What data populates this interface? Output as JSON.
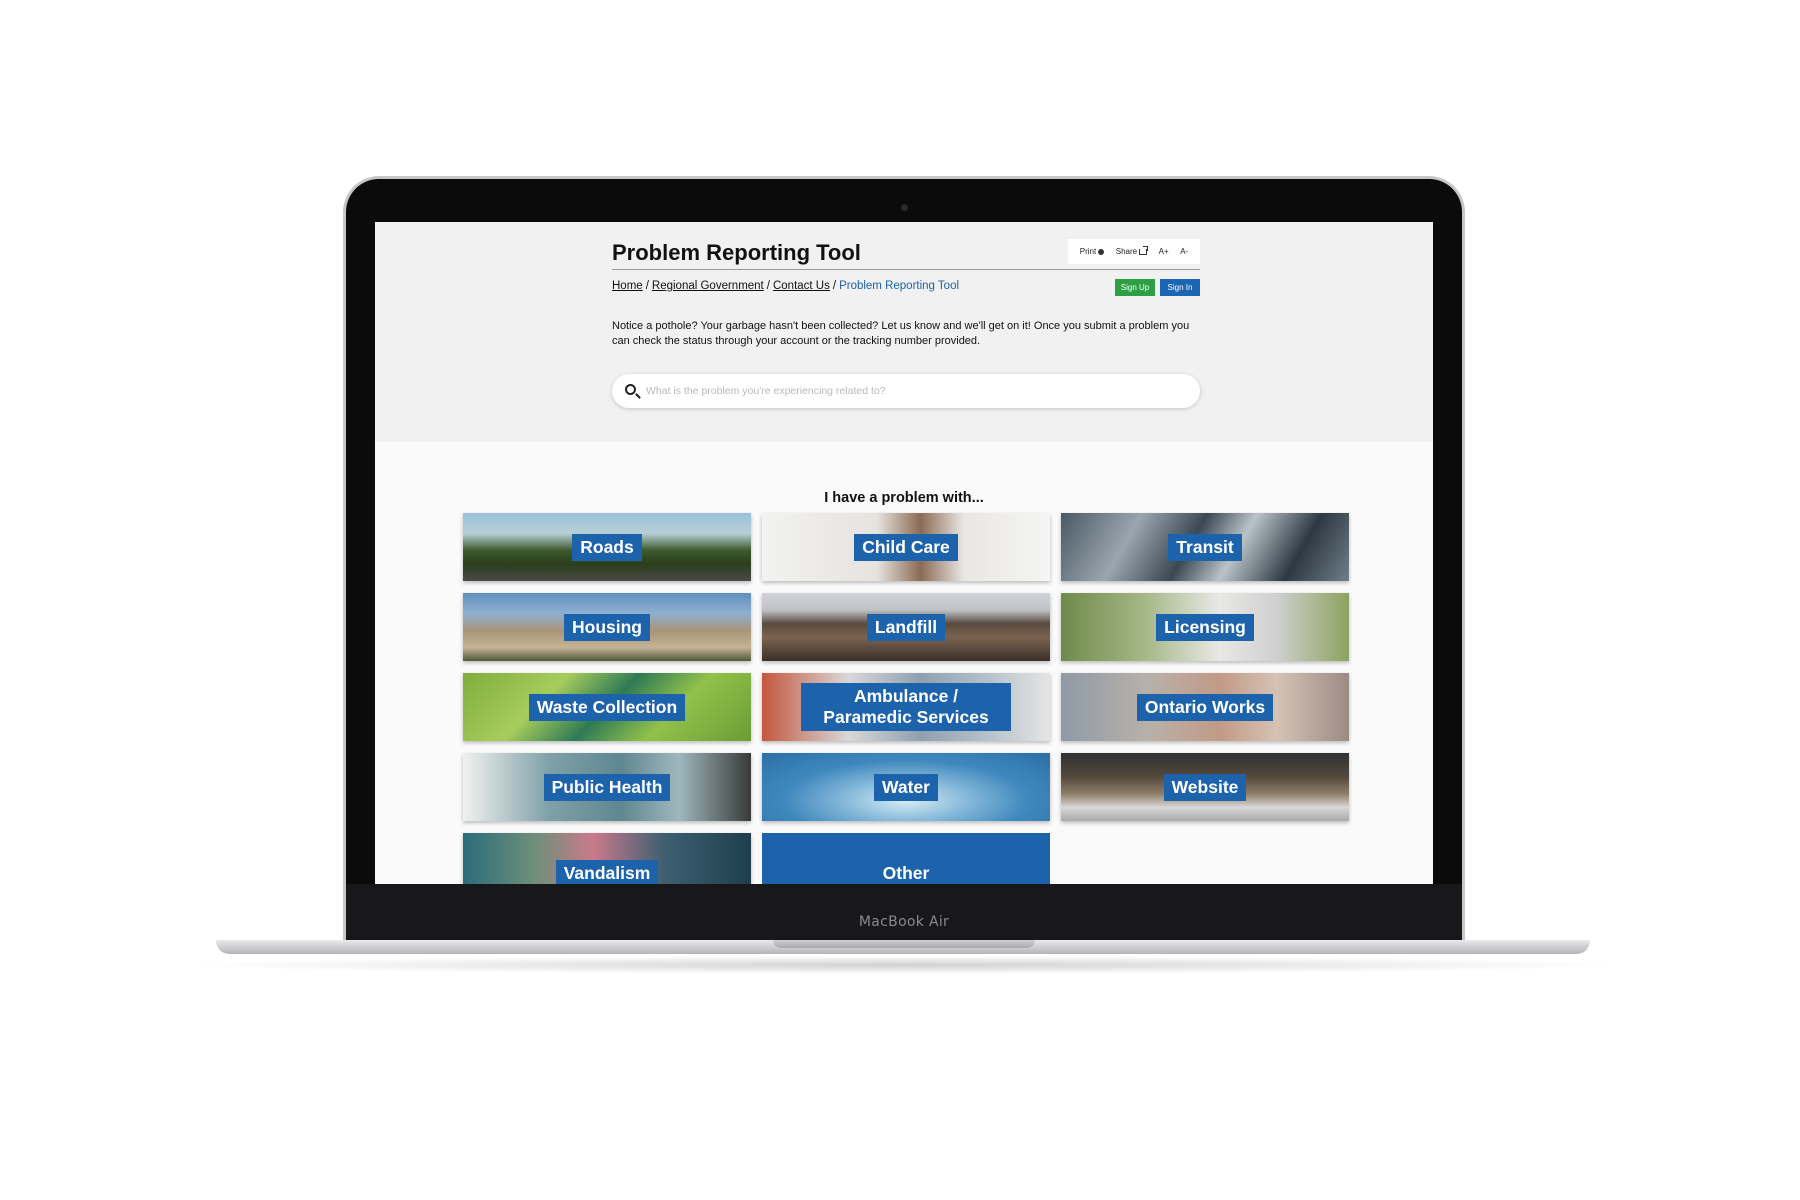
{
  "device": {
    "brand_label": "MacBook Air"
  },
  "page": {
    "title": "Problem Reporting Tool",
    "utilities": {
      "print_label": "Print",
      "share_label": "Share",
      "font_increase": "A+",
      "font_decrease": "A-"
    },
    "breadcrumb": [
      {
        "label": "Home"
      },
      {
        "label": "Regional Government"
      },
      {
        "label": "Contact Us"
      },
      {
        "label": "Problem Reporting Tool",
        "current": true
      }
    ],
    "breadcrumb_separator": "/",
    "auth": {
      "sign_up_label": "Sign Up",
      "sign_in_label": "Sign In"
    },
    "intro": "Notice a pothole? Your garbage hasn't been collected? Let us know and we'll get on it! Once you submit a problem you can check the status through your account or the tracking number provided.",
    "search": {
      "placeholder": "What is the problem you're experiencing related to?",
      "value": ""
    },
    "section_heading": "I have a problem with...",
    "categories": [
      {
        "label": "Roads"
      },
      {
        "label": "Child Care"
      },
      {
        "label": "Transit"
      },
      {
        "label": "Housing"
      },
      {
        "label": "Landfill"
      },
      {
        "label": "Licensing"
      },
      {
        "label": "Waste Collection"
      },
      {
        "label": "Ambulance / Paramedic Services"
      },
      {
        "label": "Ontario Works"
      },
      {
        "label": "Public Health"
      },
      {
        "label": "Water"
      },
      {
        "label": "Website"
      },
      {
        "label": "Vandalism"
      },
      {
        "label": "Other"
      }
    ]
  },
  "colors": {
    "accent_blue": "#1d63ab",
    "sign_up_green": "#2ea043",
    "link_blue": "#1b62a6"
  }
}
